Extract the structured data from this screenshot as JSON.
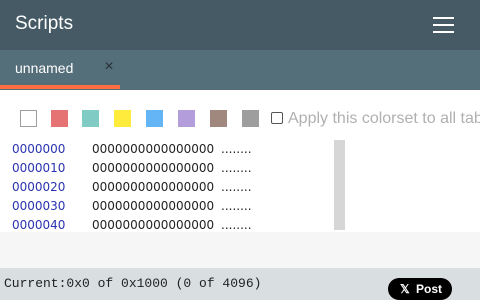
{
  "header": {
    "title": "Scripts",
    "menu_icon": "hamburger-menu-icon"
  },
  "tabs": [
    {
      "label": "unnamed",
      "close_icon": "close-icon",
      "close_glyph": "×",
      "active": true
    }
  ],
  "colors": {
    "header_bg": "#455a64",
    "tabbar_bg": "#546e7a",
    "active_tab_indicator": "#ff6e40",
    "offset_text": "#2a33b0"
  },
  "colorset": {
    "swatches": [
      {
        "name": "white",
        "color": "#ffffff"
      },
      {
        "name": "red",
        "color": "#e57373"
      },
      {
        "name": "teal",
        "color": "#80cbc4"
      },
      {
        "name": "yellow",
        "color": "#ffeb3b"
      },
      {
        "name": "blue",
        "color": "#64b5f6"
      },
      {
        "name": "purple",
        "color": "#b39ddb"
      },
      {
        "name": "brown",
        "color": "#a1887f"
      },
      {
        "name": "gray",
        "color": "#9e9e9e"
      }
    ],
    "apply_all_label": "Apply this colorset to all tab",
    "apply_all_checked": false
  },
  "hex_rows": [
    {
      "offset": "0000000",
      "bytes": "0000000000000000",
      "ascii": "........"
    },
    {
      "offset": "0000010",
      "bytes": "0000000000000000",
      "ascii": "........"
    },
    {
      "offset": "0000020",
      "bytes": "0000000000000000",
      "ascii": "........"
    },
    {
      "offset": "0000030",
      "bytes": "0000000000000000",
      "ascii": "........"
    },
    {
      "offset": "0000040",
      "bytes": "0000000000000000",
      "ascii": "........"
    }
  ],
  "status": {
    "text": "Current:0x0 of 0x1000 (0 of 4096)"
  },
  "post_button": {
    "icon": "x-logo-icon",
    "icon_glyph": "𝕏",
    "label": "Post"
  }
}
